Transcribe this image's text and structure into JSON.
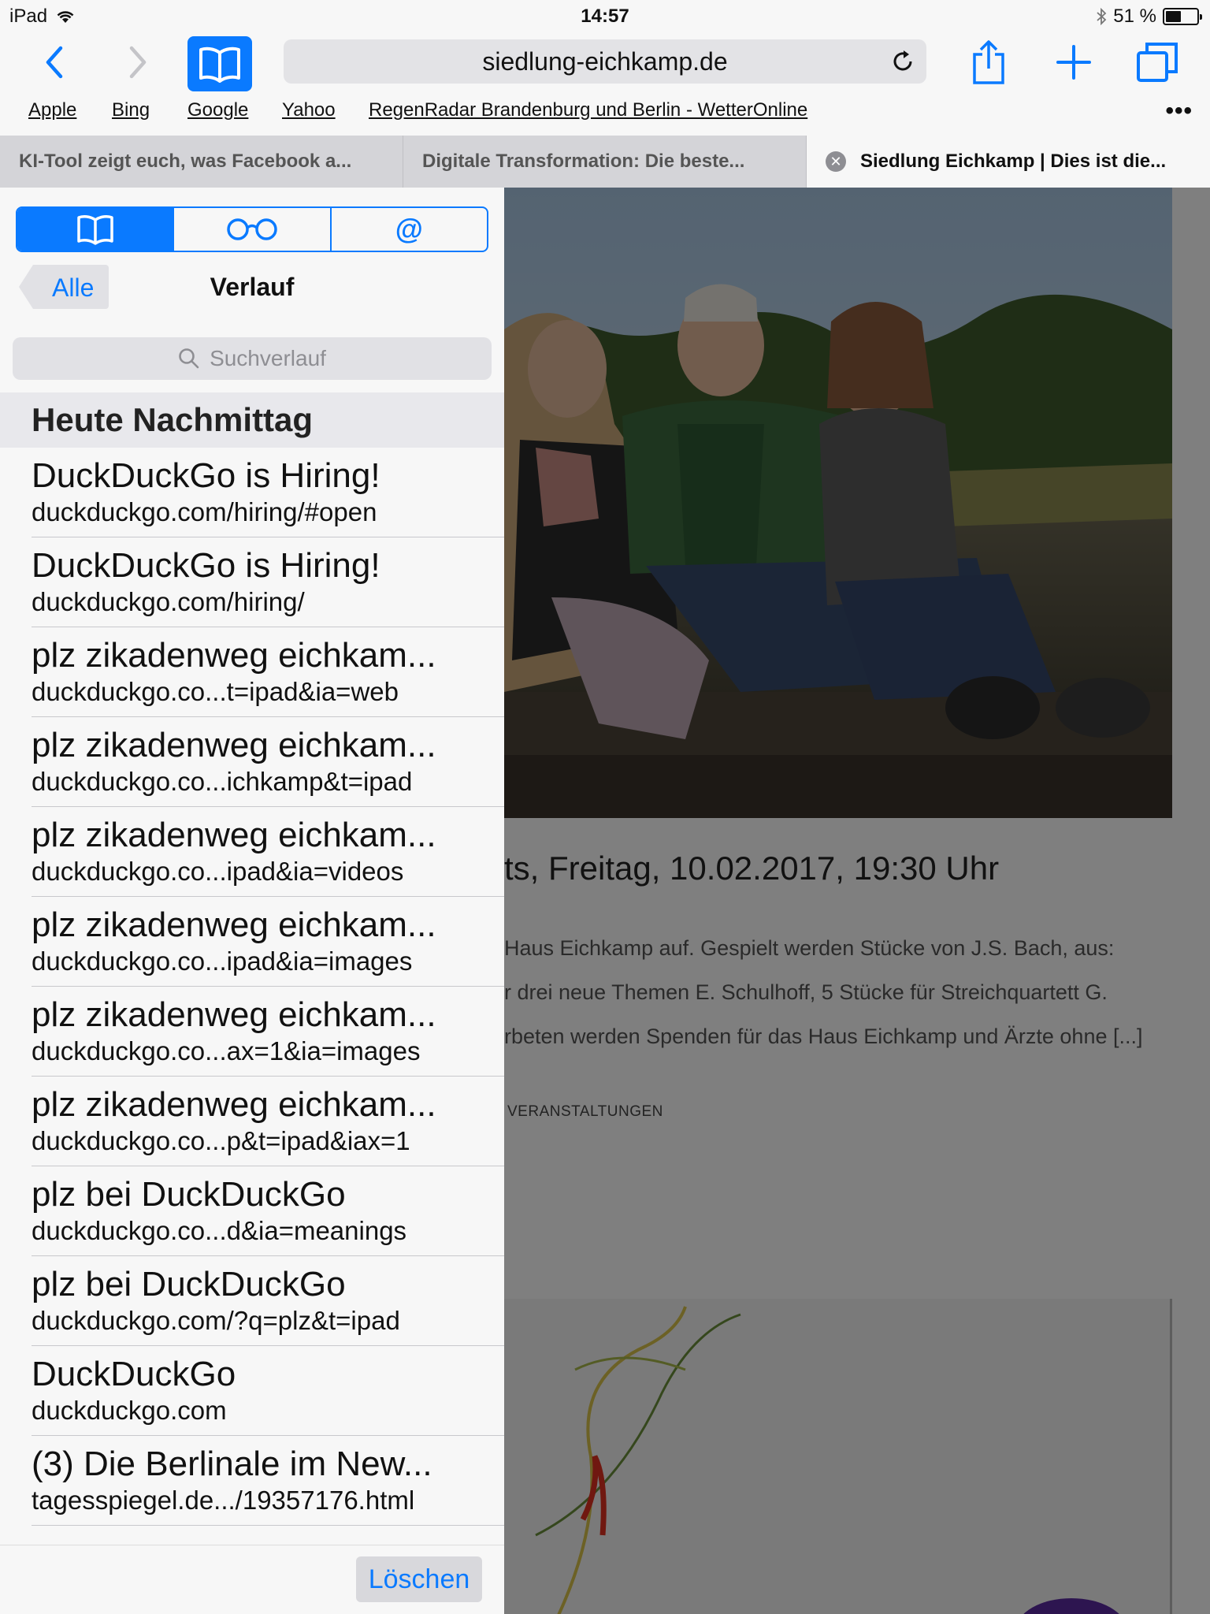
{
  "status_bar": {
    "device": "iPad",
    "time": "14:57",
    "battery": "51 %",
    "battery_level": 0.51
  },
  "toolbar": {
    "url": "siedlung-eichkamp.de"
  },
  "bookmarks": [
    "Apple",
    "Bing",
    "Google",
    "Yahoo",
    "RegenRadar Brandenburg und Berlin - WetterOnline"
  ],
  "tabs": [
    {
      "title": "KI-Tool zeigt euch, was Facebook a..."
    },
    {
      "title": "Digitale Transformation: Die beste..."
    },
    {
      "title": "Siedlung Eichkamp | Dies ist die..."
    }
  ],
  "sidebar": {
    "back_label": "Alle",
    "title": "Verlauf",
    "search_placeholder": "Suchverlauf",
    "section": "Heute Nachmittag",
    "delete_label": "Löschen",
    "items": [
      {
        "title": "DuckDuckGo is Hiring!",
        "url": "duckduckgo.com/hiring/#open"
      },
      {
        "title": "DuckDuckGo is Hiring!",
        "url": "duckduckgo.com/hiring/"
      },
      {
        "title": "plz zikadenweg eichkam...",
        "url": "duckduckgo.co...t=ipad&ia=web"
      },
      {
        "title": "plz zikadenweg eichkam...",
        "url": "duckduckgo.co...ichkamp&t=ipad"
      },
      {
        "title": "plz zikadenweg eichkam...",
        "url": "duckduckgo.co...ipad&ia=videos"
      },
      {
        "title": "plz zikadenweg eichkam...",
        "url": "duckduckgo.co...ipad&ia=images"
      },
      {
        "title": "plz zikadenweg eichkam...",
        "url": "duckduckgo.co...ax=1&ia=images"
      },
      {
        "title": "plz zikadenweg eichkam...",
        "url": "duckduckgo.co...p&t=ipad&iax=1"
      },
      {
        "title": "plz bei DuckDuckGo",
        "url": "duckduckgo.co...d&ia=meanings"
      },
      {
        "title": "plz bei DuckDuckGo",
        "url": "duckduckgo.com/?q=plz&t=ipad"
      },
      {
        "title": "DuckDuckGo",
        "url": "duckduckgo.com"
      },
      {
        "title": "(3) Die Berlinale im New...",
        "url": "tagesspiegel.de.../19357176.html"
      }
    ]
  },
  "page": {
    "event_title": "ts, Freitag, 10.02.2017, 19:30 Uhr",
    "lines": [
      "Haus Eichkamp auf. Gespielt werden Stücke von J.S. Bach, aus:",
      "r drei neue Themen E. Schulhoff, 5 Stücke für Streichquartett G.",
      "rbeten werden Spenden für das Haus Eichkamp und Ärzte ohne [...]"
    ],
    "category": "VERANSTALTUNGEN"
  }
}
